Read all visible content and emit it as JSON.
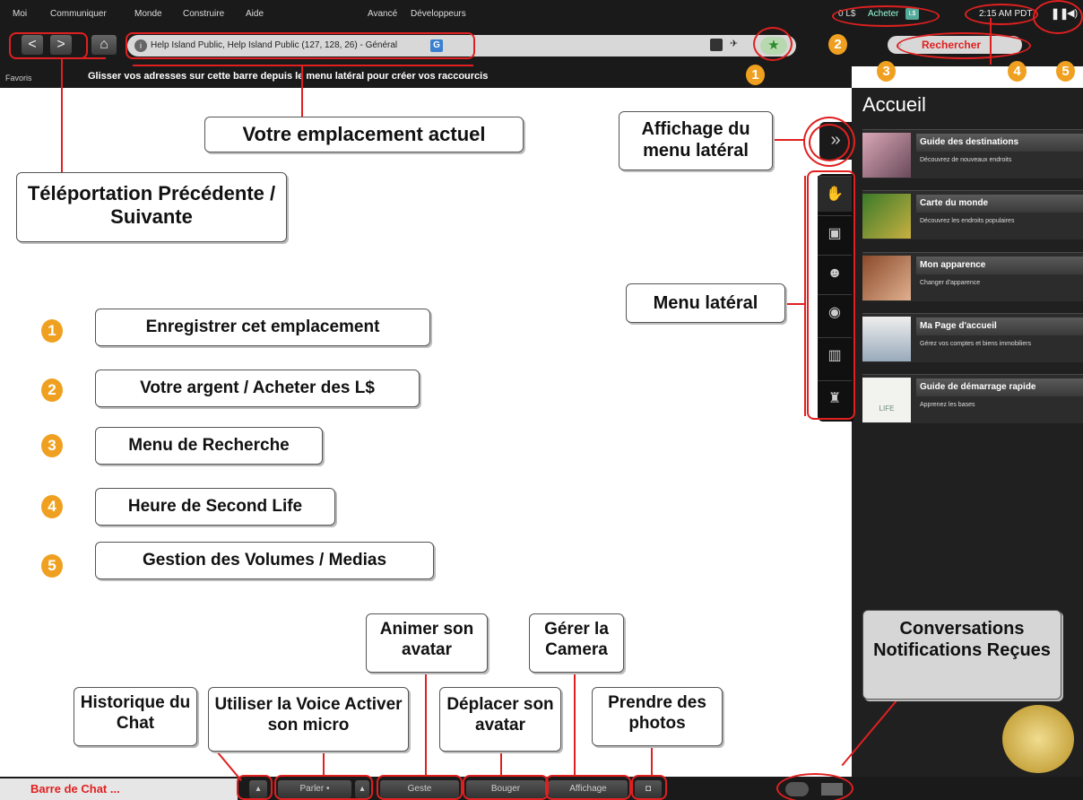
{
  "menubar": {
    "items": [
      "Moi",
      "Communiquer",
      "Monde",
      "Construire",
      "Aide",
      "Avancé",
      "Développeurs"
    ],
    "balance": "0 L$",
    "buy": "Acheter",
    "buy_icon": "L$",
    "clock": "2:15 AM PDT"
  },
  "navbar": {
    "back_label": "<",
    "forward_label": ">",
    "home_icon": "home-icon",
    "location": "Help Island Public, Help Island Public (127, 128, 26) - Général",
    "rating": "G",
    "search_label": "Rechercher"
  },
  "favbar": {
    "label": "Favoris",
    "hint": "Glisser vos adresses sur cette barre depuis le menu latéral pour créer vos raccourcis"
  },
  "sidebar": {
    "title": "Accueil",
    "cards": [
      {
        "title": "Guide des destinations",
        "desc": "Découvrez de nouveaux endroits"
      },
      {
        "title": "Carte du monde",
        "desc": "Découvrez les endroits populaires"
      },
      {
        "title": "Mon apparence",
        "desc": "Changer d'apparence"
      },
      {
        "title": "Ma Page d'accueil",
        "desc": "Gérez vos comptes et biens immobiliers"
      },
      {
        "title": "Guide de démarrage rapide",
        "desc": "Apprenez les bases"
      }
    ],
    "life_logo": "LIFE",
    "collapse_icon": "»"
  },
  "callouts": {
    "location": "Votre emplacement actuel",
    "sidebar_toggle": "Affichage du menu latéral",
    "teleport": "Téléportation Précédente / Suivante",
    "sidebar_menu": "Menu latéral",
    "conversations": "Conversations Notifications Reçues",
    "history": "Historique du Chat",
    "voice": "Utiliser la Voice Activer son micro",
    "animate": "Animer son avatar",
    "move": "Déplacer son avatar",
    "camera": "Gérer la Camera",
    "photos": "Prendre des photos"
  },
  "legend": [
    {
      "n": "1",
      "text": "Enregistrer cet emplacement"
    },
    {
      "n": "2",
      "text": "Votre argent / Acheter des L$"
    },
    {
      "n": "3",
      "text": "Menu de Recherche"
    },
    {
      "n": "4",
      "text": "Heure de Second Life"
    },
    {
      "n": "5",
      "text": "Gestion des Volumes / Medias"
    }
  ],
  "badges": [
    "1",
    "2",
    "3",
    "4",
    "5"
  ],
  "bottombar": {
    "chat": "Barre de Chat ...",
    "speak": "Parler",
    "gesture": "Geste",
    "move": "Bouger",
    "view": "Affichage"
  },
  "colors": {
    "accent_red": "#e02020",
    "badge_orange": "#f0a020",
    "chrome": "#1a1a1a"
  }
}
